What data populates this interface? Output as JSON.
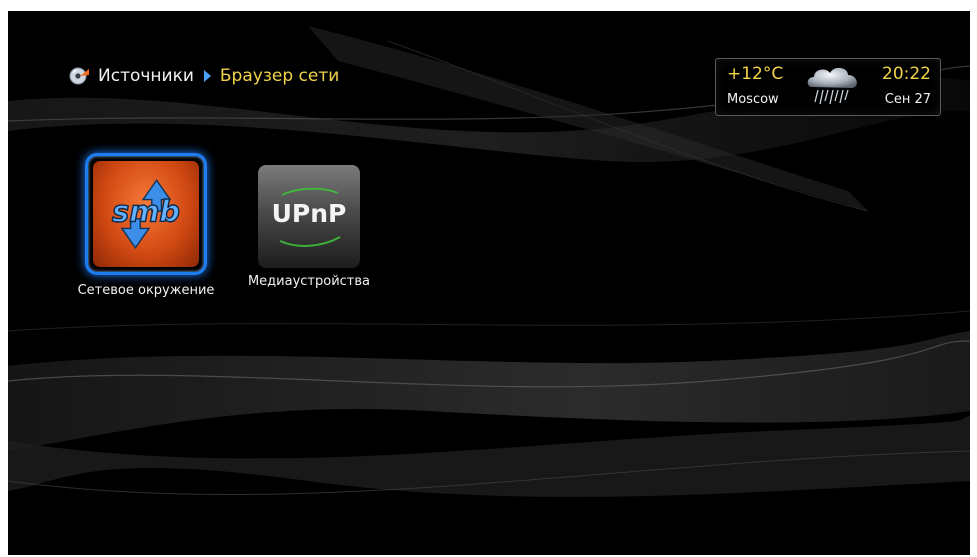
{
  "breadcrumb": {
    "root": "Источники",
    "current": "Браузер сети"
  },
  "weather": {
    "temperature": "+12°C",
    "city": "Moscow",
    "time": "20:22",
    "date": "Сен 27",
    "icon": "rain-cloud-icon"
  },
  "items": [
    {
      "label": "Сетевое окружение",
      "logo_text": "smb",
      "icon": "smb-network-icon",
      "selected": true
    },
    {
      "label": "Медиаустройства",
      "logo_text": "UPnP",
      "icon": "upnp-icon",
      "selected": false
    }
  ],
  "colors": {
    "accent": "#f1d44a",
    "selection": "#1e7cf2",
    "smb_tile": "#d24a13",
    "background": "#000000"
  }
}
